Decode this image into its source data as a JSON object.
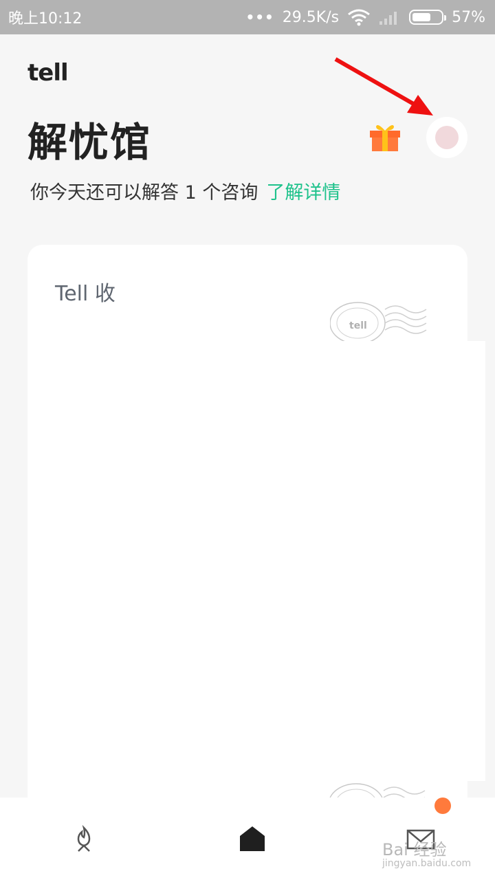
{
  "status_bar": {
    "time": "晚上10:12",
    "net_speed": "29.5K/s",
    "battery": "57%",
    "dots": "•••"
  },
  "header": {
    "logo": "tell",
    "title": "解忧馆",
    "subtitle": "你今天还可以解答 1 个咨询",
    "link": "了解详情"
  },
  "card": {
    "label": "Tell 收"
  },
  "bottom_nav": {
    "items": [
      "fire-icon",
      "home-icon",
      "mail-icon"
    ]
  },
  "watermark": {
    "text": "Bai 经验",
    "sub": "jingyan.baidu.com"
  }
}
